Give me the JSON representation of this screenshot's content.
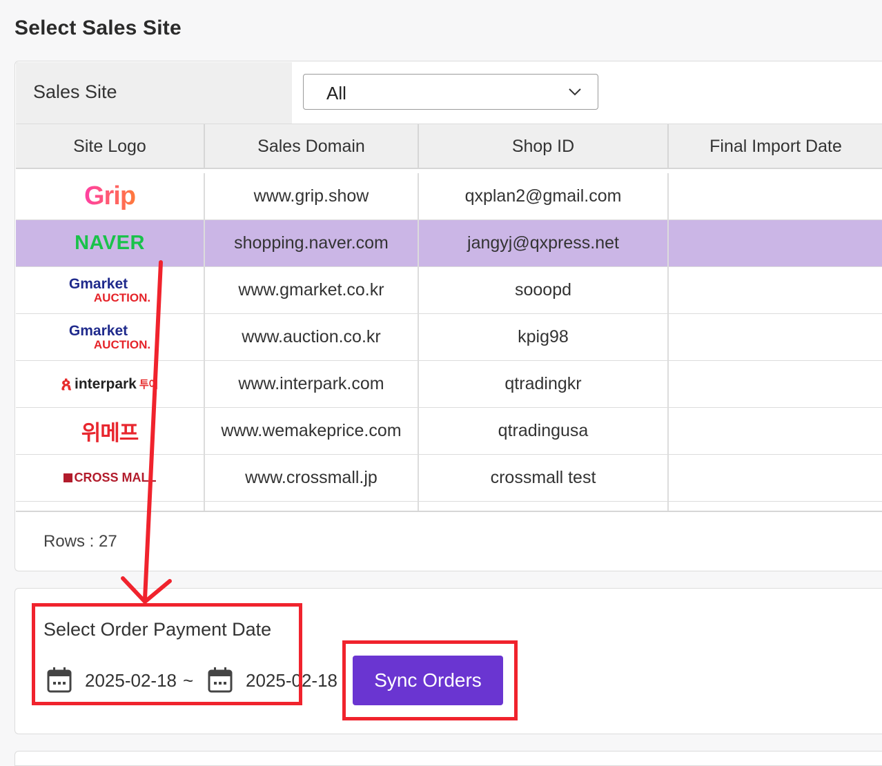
{
  "page": {
    "title": "Select Sales Site"
  },
  "filter": {
    "label": "Sales Site",
    "select_value": "All"
  },
  "table": {
    "headers": [
      "Site Logo",
      "Sales Domain",
      "Shop ID",
      "Final Import Date"
    ],
    "rows": [
      {
        "logo": "Grip",
        "domain": "www.grip.show",
        "shop_id": "qxplan2@gmail.com",
        "final_import_date": ""
      },
      {
        "logo": "NAVER",
        "domain": "shopping.naver.com",
        "shop_id": "jangyj@qxpress.net",
        "final_import_date": ""
      },
      {
        "logo_top": "Gmarket",
        "logo_bottom": "AUCTION.",
        "domain": "www.gmarket.co.kr",
        "shop_id": "sooopd",
        "final_import_date": ""
      },
      {
        "logo_top": "Gmarket",
        "logo_bottom": "AUCTION.",
        "domain": "www.auction.co.kr",
        "shop_id": "kpig98",
        "final_import_date": ""
      },
      {
        "logo": "interpark",
        "logo_extra": "투어",
        "domain": "www.interpark.com",
        "shop_id": "qtradingkr",
        "final_import_date": ""
      },
      {
        "logo": "위메프",
        "domain": "www.wemakeprice.com",
        "shop_id": "qtradingusa",
        "final_import_date": ""
      },
      {
        "logo": "CROSS MALL",
        "domain": "www.crossmall.jp",
        "shop_id": "crossmall test",
        "final_import_date": ""
      }
    ],
    "selected_row": 1,
    "rows_label": "Rows : 27"
  },
  "order_date": {
    "title": "Select Order Payment Date",
    "start": "2025-02-18",
    "separator": "~",
    "end": "2025-02-18"
  },
  "sync_button": {
    "label": "Sync Orders",
    "color": "#6a35d1"
  },
  "colors": {
    "selected_row": "#cbb6e6",
    "header_bg": "#efefef",
    "highlight": "#f0232d"
  },
  "icons": [
    "chevron-down-icon",
    "calendar-icon",
    "annotation-arrow"
  ]
}
